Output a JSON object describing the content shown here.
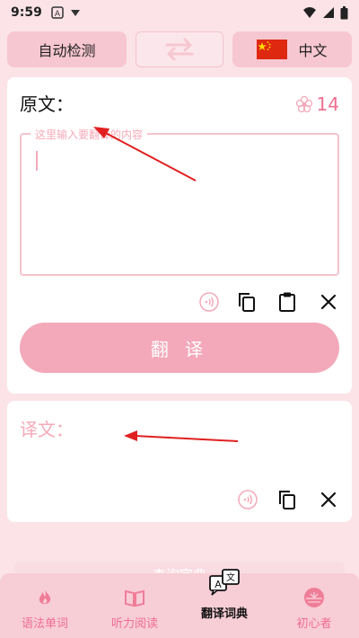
{
  "status": {
    "time": "9:59",
    "icons": [
      "a-badge-icon",
      "drop-icon",
      "wifi-icon",
      "signal-icon",
      "battery-icon"
    ]
  },
  "lang_bar": {
    "source_label": "自动检测",
    "target_label": "中文",
    "swap_icon": "swap-arrows-icon",
    "flag": "china-flag-icon"
  },
  "source_card": {
    "title": "原文：",
    "char_count": "14",
    "input_placeholder": "这里输入要翻译的内容",
    "input_value": "",
    "translate_label": "翻 译",
    "tools": [
      "speak-icon",
      "copy-icon",
      "paste-icon",
      "close-icon"
    ]
  },
  "result_card": {
    "title": "译文：",
    "tools": [
      "speak-icon",
      "copy-icon",
      "close-icon"
    ]
  },
  "bottom_faded_text": "查询字典",
  "nav": {
    "items": [
      {
        "label": "语法单词",
        "icon": "flame-icon"
      },
      {
        "label": "听力阅读",
        "icon": "book-icon"
      },
      {
        "label": "翻译词典",
        "icon": "translate-icon",
        "active": true
      },
      {
        "label": "初心者",
        "icon": "sun-emblem-icon"
      }
    ]
  },
  "colors": {
    "accent": "#f3a9b9",
    "pink_text": "#ef6f8f",
    "background": "#fbe3e8",
    "arrow": "#e02020"
  }
}
